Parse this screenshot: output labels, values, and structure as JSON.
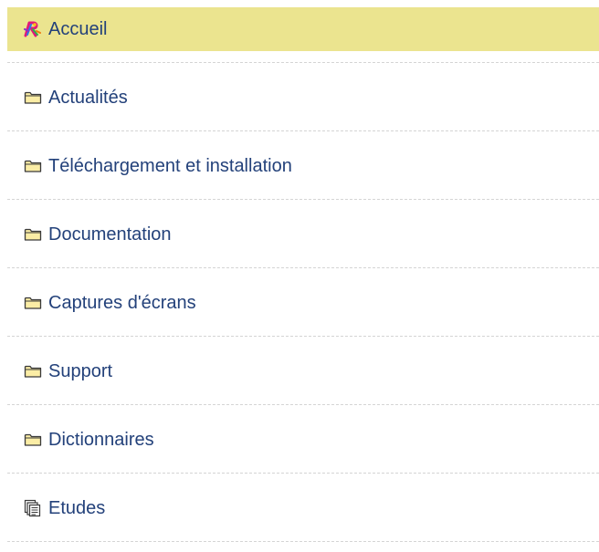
{
  "menu": {
    "items": [
      {
        "label": "Accueil",
        "icon": "rainbow-logo-icon",
        "active": true
      },
      {
        "label": "Actualités",
        "icon": "folder-icon"
      },
      {
        "label": "Téléchargement et installation",
        "icon": "folder-icon"
      },
      {
        "label": "Documentation",
        "icon": "folder-icon"
      },
      {
        "label": "Captures d'écrans",
        "icon": "folder-icon"
      },
      {
        "label": "Support",
        "icon": "folder-icon"
      },
      {
        "label": "Dictionnaires",
        "icon": "folder-icon"
      },
      {
        "label": "Etudes",
        "icon": "documents-icon"
      }
    ]
  },
  "colors": {
    "active_background": "#ebe48f",
    "link_text": "#23417a",
    "separator": "#d4d4d4",
    "folder_fill": "#fbeda5",
    "folder_stroke": "#3a3a3a"
  }
}
